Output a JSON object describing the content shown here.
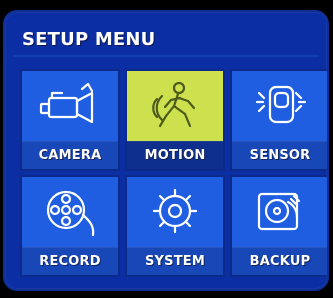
{
  "menu": {
    "title": "SETUP MENU",
    "items": [
      {
        "label": "CAMERA",
        "icon": "camera-icon",
        "selected": false
      },
      {
        "label": "MOTION",
        "icon": "motion-icon",
        "selected": true
      },
      {
        "label": "SENSOR",
        "icon": "sensor-icon",
        "selected": false
      },
      {
        "label": "RECORD",
        "icon": "record-icon",
        "selected": false
      },
      {
        "label": "SYSTEM",
        "icon": "system-icon",
        "selected": false
      },
      {
        "label": "BACKUP",
        "icon": "backup-icon",
        "selected": false
      }
    ]
  },
  "colors": {
    "panel": "#0b2ea4",
    "tile": "#1f5ee1",
    "tile_selected": "#cde14f",
    "label_bar": "#1847b8",
    "label_bar_selected": "#0f2f8c",
    "text": "#ffffff"
  }
}
